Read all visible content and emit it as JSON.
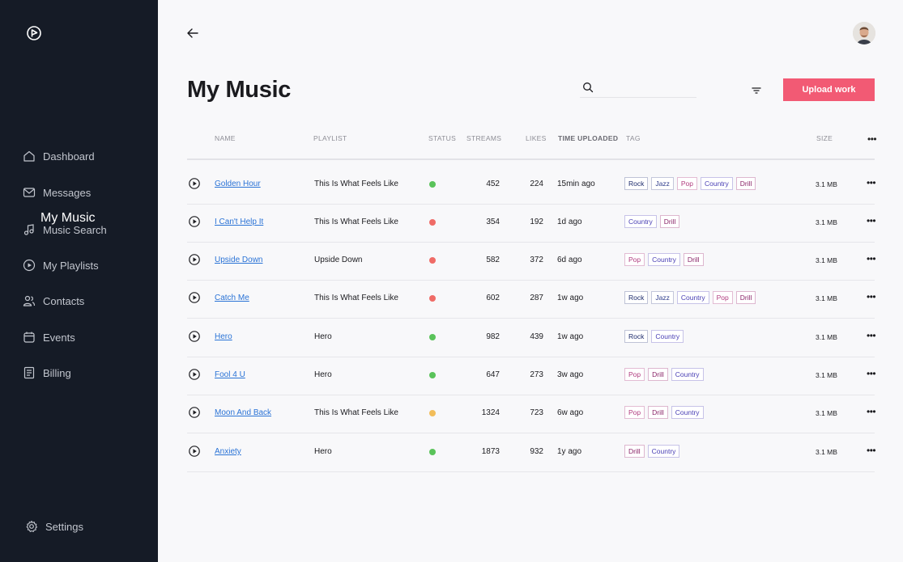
{
  "sidebar": {
    "items": [
      {
        "label": "Dashboard",
        "icon": "home-icon"
      },
      {
        "label": "Messages",
        "icon": "mail-icon"
      },
      {
        "label": "Music Search",
        "icon": "music-note-icon"
      },
      {
        "label": "My Playlists",
        "icon": "play-circle-icon"
      },
      {
        "label": "Contacts",
        "icon": "users-icon"
      },
      {
        "label": "Events",
        "icon": "calendar-icon"
      },
      {
        "label": "Billing",
        "icon": "receipt-icon"
      }
    ],
    "active_label": "My Music",
    "settings_label": "Settings"
  },
  "header": {
    "title": "My Music",
    "search_placeholder": "",
    "upload_label": "Upload work"
  },
  "table": {
    "columns": [
      "NAME",
      "PLAYLIST",
      "STATUS",
      "STREAMS",
      "LIKES",
      "TIME UPLOADED",
      "TAG",
      "SIZE"
    ],
    "more_label": "•••",
    "rows": [
      {
        "name": "Golden Hour",
        "playlist": "This Is What Feels Like",
        "status": "green",
        "streams": "452",
        "likes": "224",
        "time": "15min ago",
        "tags": [
          "Rock",
          "Jazz",
          "Pop",
          "Country",
          "Drill"
        ],
        "size": "3.1 MB"
      },
      {
        "name": "I Can't Help It",
        "playlist": "This Is What Feels Like",
        "status": "red",
        "streams": "354",
        "likes": "192",
        "time": "1d ago",
        "tags": [
          "Country",
          "Drill"
        ],
        "size": "3.1 MB"
      },
      {
        "name": "Upside Down",
        "playlist": "Upside Down",
        "status": "red",
        "streams": "582",
        "likes": "372",
        "time": "6d ago",
        "tags": [
          "Pop",
          "Country",
          "Drill"
        ],
        "size": "3.1 MB"
      },
      {
        "name": "Catch Me",
        "playlist": "This Is What Feels Like",
        "status": "red",
        "streams": "602",
        "likes": "287",
        "time": "1w ago",
        "tags": [
          "Rock",
          "Jazz",
          "Country",
          "Pop",
          "Drill"
        ],
        "size": "3.1 MB"
      },
      {
        "name": "Hero",
        "playlist": "Hero",
        "status": "green",
        "streams": "982",
        "likes": "439",
        "time": "1w ago",
        "tags": [
          "Rock",
          "Country"
        ],
        "size": "3.1 MB"
      },
      {
        "name": "Fool 4 U",
        "playlist": "Hero",
        "status": "green",
        "streams": "647",
        "likes": "273",
        "time": "3w ago",
        "tags": [
          "Pop",
          "Drill",
          "Country"
        ],
        "size": "3.1 MB"
      },
      {
        "name": "Moon And Back",
        "playlist": "This Is What Feels Like",
        "status": "yellow",
        "streams": "1324",
        "likes": "723",
        "time": "6w ago",
        "tags": [
          "Pop",
          "Drill",
          "Country"
        ],
        "size": "3.1 MB"
      },
      {
        "name": "Anxiety",
        "playlist": "Hero",
        "status": "green",
        "streams": "1873",
        "likes": "932",
        "time": "1y ago",
        "tags": [
          "Drill",
          "Country"
        ],
        "size": "3.1 MB"
      }
    ]
  },
  "colors": {
    "sidebar_bg": "#151b26",
    "accent": "#f25a74",
    "status_green": "#5ac35a",
    "status_red": "#ef6b66",
    "status_yellow": "#f2bd5a",
    "link": "#2a73d6"
  }
}
